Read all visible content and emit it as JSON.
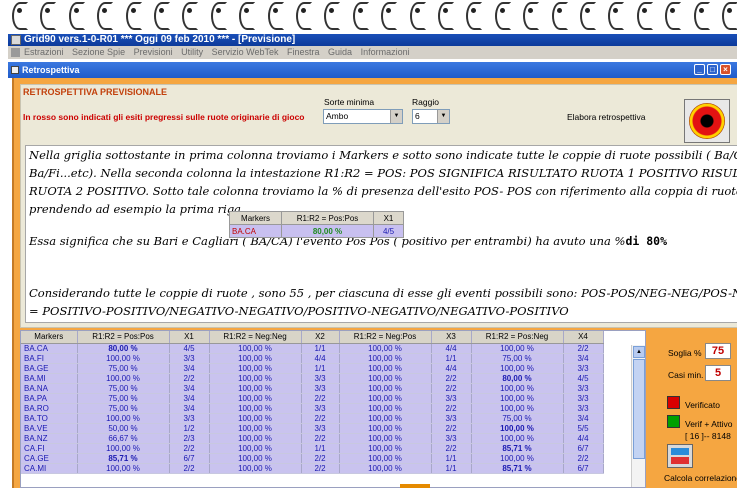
{
  "app": {
    "title": "Grid90 vers.1-0-R01   ***   Oggi 09 feb 2010   ***   - [Previsione]",
    "menu": [
      "Estrazioni",
      "Sezione Spie",
      "Previsioni",
      "Utility",
      "Servizio WebTek",
      "Finestra",
      "Guida",
      "Informazioni"
    ]
  },
  "window": {
    "title": "Retrospettiva",
    "min": "_",
    "max": "□",
    "close": "×"
  },
  "section": {
    "title": "RETROSPETTIVA PREVISIONALE",
    "subtitle": "In rosso sono indicati gli esiti pregressi sulle ruote originarie di gioco",
    "sort_label": "Sorte minima",
    "sort_value": "Ambo",
    "radius_label": "Raggio",
    "radius_value": "6",
    "elabora_label": "Elabora retrospettiva"
  },
  "text": {
    "l1": "Nella griglia sottostante in prima colonna troviamo i Markers e sotto sono indicate tutte le coppie di ruote possibili ( Ba/Ca",
    "l2": "Ba/Fi...etc). Nella seconda colonna la intestazione R1:R2 = POS: POS SIGNIFICA RISULTATO RUOTA 1 POSITIVO RISULTATO",
    "l3": "RUOTA 2 POSITIVO. Sotto tale colonna troviamo la % di presenza dell'esito POS- POS  con riferimento alla coppia di ruote. Quin",
    "l4": "prendendo ad esempio la prima riga",
    "l5a": "Essa significa che su Bari e Cagliari ( BA/CA) l'evento Pos Pos ( positivo per entrambi) ha avuto una %",
    "l5b": "di  80%",
    "l6": "Considerando tutte le coppie di ruote , sono 55 , per ciascuna di esse gli eventi possibili sono: POS-POS/NEG-NEG/POS-NEG/NEG-PO",
    "l7": "= POSITIVO-POSITIVO/NEGATIVO-NEGATIVO/POSITIVO-NEGATIVO/NEGATIVO-POSITIVO"
  },
  "mini_table": {
    "headers": [
      "Markers",
      "R1:R2 = Pos:Pos",
      "X1"
    ],
    "row": [
      "BA.CA",
      "80,00 %",
      "4/5"
    ]
  },
  "grid": {
    "headers": [
      "Markers",
      "R1:R2 = Pos:Pos",
      "X1",
      "R1:R2 = Neg:Neg",
      "X2",
      "R1:R2 = Neg:Pos",
      "X3",
      "R1:R2 = Pos:Neg",
      "X4"
    ],
    "rows": [
      [
        "BA.CA",
        "80,00 %",
        "4/5",
        "100,00 %",
        "1/1",
        "100,00 %",
        "4/4",
        "100,00 %",
        "2/2"
      ],
      [
        "BA.FI",
        "100,00 %",
        "3/3",
        "100,00 %",
        "4/4",
        "100,00 %",
        "1/1",
        "75,00 %",
        "3/4"
      ],
      [
        "BA.GE",
        "75,00 %",
        "3/4",
        "100,00 %",
        "1/1",
        "100,00 %",
        "4/4",
        "100,00 %",
        "3/3"
      ],
      [
        "BA.MI",
        "100,00 %",
        "2/2",
        "100,00 %",
        "3/3",
        "100,00 %",
        "2/2",
        "80,00 %",
        "4/5"
      ],
      [
        "BA.NA",
        "75,00 %",
        "3/4",
        "100,00 %",
        "3/3",
        "100,00 %",
        "2/2",
        "100,00 %",
        "3/3"
      ],
      [
        "BA.PA",
        "75,00 %",
        "3/4",
        "100,00 %",
        "2/2",
        "100,00 %",
        "3/3",
        "100,00 %",
        "3/3"
      ],
      [
        "BA.RO",
        "75,00 %",
        "3/4",
        "100,00 %",
        "3/3",
        "100,00 %",
        "2/2",
        "100,00 %",
        "3/3"
      ],
      [
        "BA.TO",
        "100,00 %",
        "3/3",
        "100,00 %",
        "2/2",
        "100,00 %",
        "3/3",
        "75,00 %",
        "3/4"
      ],
      [
        "BA.VE",
        "50,00 %",
        "1/2",
        "100,00 %",
        "3/3",
        "100,00 %",
        "2/2",
        "100,00 %",
        "5/5"
      ],
      [
        "BA.NZ",
        "66,67 %",
        "2/3",
        "100,00 %",
        "2/2",
        "100,00 %",
        "3/3",
        "100,00 %",
        "4/4"
      ],
      [
        "CA.FI",
        "100,00 %",
        "2/2",
        "100,00 %",
        "1/1",
        "100,00 %",
        "2/2",
        "85,71 %",
        "6/7"
      ],
      [
        "CA.GE",
        "85,71 %",
        "6/7",
        "100,00 %",
        "2/2",
        "100,00 %",
        "1/1",
        "100,00 %",
        "2/2"
      ],
      [
        "CA.MI",
        "100,00 %",
        "2/2",
        "100,00 %",
        "2/2",
        "100,00 %",
        "1/1",
        "85,71 %",
        "6/7"
      ]
    ],
    "green_cells": [
      "0.1",
      "3.7",
      "10.7",
      "11.1",
      "12.7"
    ],
    "red_cells": [
      "8.7"
    ]
  },
  "side": {
    "soglia_label": "Soglia %",
    "soglia_value": "75",
    "casi_label": "Casi min.",
    "casi_value": "5",
    "verificato_label": "Verificato",
    "verif_attivo_label": "Verif + Attivo",
    "counter_label": "[ 16 ]-- 8148",
    "corr_label": "Calcola correlazione",
    "colors": {
      "verificato": "#d80000",
      "verif_attivo": "#00a000"
    }
  }
}
